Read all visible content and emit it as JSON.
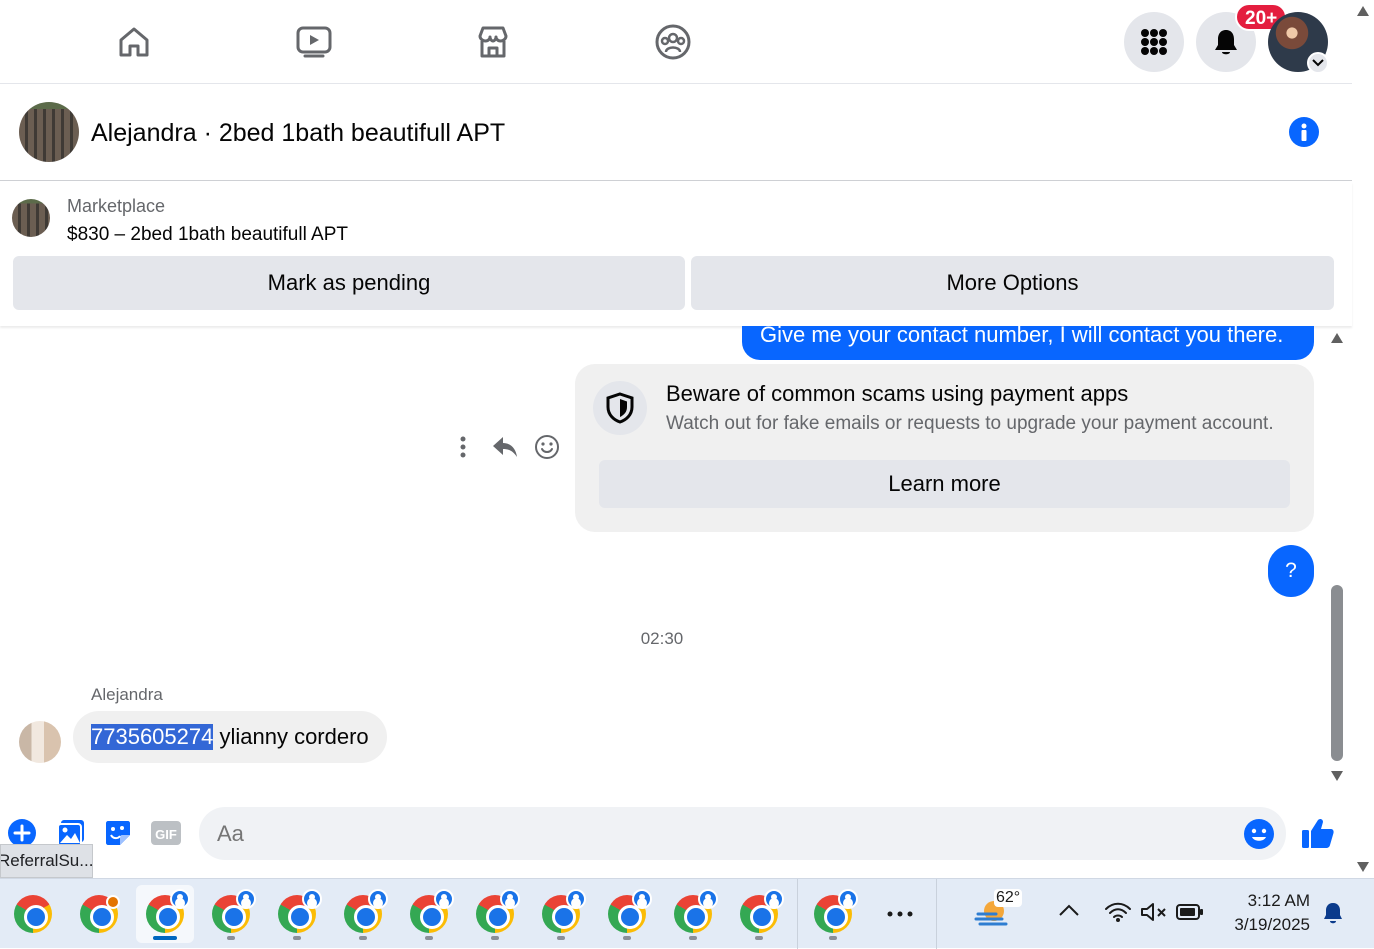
{
  "nav": {
    "items": [
      "home",
      "video",
      "marketplace",
      "groups"
    ],
    "notifications_badge": "20+"
  },
  "chat": {
    "title": "Alejandra · 2bed 1bath beautifull APT",
    "marketplace_label": "Marketplace",
    "listing_line": "$830 – 2bed 1bath beautifull APT",
    "mark_pending_label": "Mark as pending",
    "more_options_label": "More Options"
  },
  "messages": {
    "outgoing_1": "Give me your contact number, I will contact you there.",
    "scam_title": "Beware of common scams using payment apps",
    "scam_body": "Watch out for fake emails or requests to upgrade your payment account.",
    "learn_more_label": "Learn more",
    "outgoing_2": "?",
    "timestamp": "02:30",
    "sender_name": "Alejandra",
    "incoming_number": "7735605274",
    "incoming_rest": " ylianny cordero"
  },
  "composer": {
    "placeholder": "Aa"
  },
  "tooltip": {
    "text": "ReferralSu..."
  },
  "taskbar": {
    "weather_temp": "62°",
    "time": "3:12 AM",
    "date": "3/19/2025"
  },
  "colors": {
    "brand_blue": "#0866ff",
    "badge_red": "#e41e3f",
    "selection": "#3367d6"
  }
}
